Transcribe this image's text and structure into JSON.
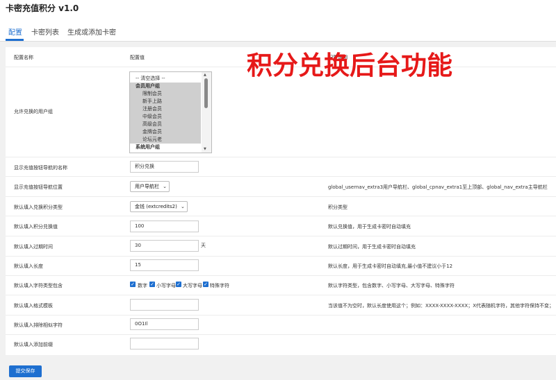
{
  "app": {
    "title": "卡密充值积分 v1.0"
  },
  "tabs": [
    {
      "label": "配置",
      "active": true
    },
    {
      "label": "卡密列表",
      "active": false
    },
    {
      "label": "生成或添加卡密",
      "active": false
    }
  ],
  "table": {
    "headers": {
      "name": "配置名称",
      "value": "配置值",
      "desc": "配置说明"
    }
  },
  "rows": {
    "user_groups": {
      "label": "允许兑换的用户组",
      "options": [
        {
          "text": "-- 清空选择 --",
          "kind": "clear",
          "selected": false
        },
        {
          "text": "会员用户组",
          "kind": "group",
          "selected": true
        },
        {
          "text": "限制会员",
          "kind": "opt",
          "selected": true
        },
        {
          "text": "新手上路",
          "kind": "opt",
          "selected": true
        },
        {
          "text": "注册会员",
          "kind": "opt",
          "selected": true
        },
        {
          "text": "中级会员",
          "kind": "opt",
          "selected": true
        },
        {
          "text": "高级会员",
          "kind": "opt",
          "selected": true
        },
        {
          "text": "金牌会员",
          "kind": "opt",
          "selected": true
        },
        {
          "text": "论坛元老",
          "kind": "opt",
          "selected": true
        },
        {
          "text": "系统用户组",
          "kind": "group",
          "selected": false
        }
      ]
    },
    "button_name": {
      "label": "显示充值按钮导航的名称",
      "value": "积分兑换"
    },
    "button_position": {
      "label": "显示充值按钮导航位置",
      "value": "用户导航栏",
      "desc": "global_usernav_extra3用户导航栏、global_cpnav_extra1至上顶部、global_nav_extra主导航栏"
    },
    "credit_type": {
      "label": "默认填入兑换积分类型",
      "value": "金钱 (extcredits2)",
      "desc": "积分类型"
    },
    "credit_value": {
      "label": "默认填入积分兑换值",
      "value": "100",
      "desc": "默认兑换值，用于生成卡密时自动填充"
    },
    "expire_time": {
      "label": "默认填入过期时间",
      "value": "30",
      "unit": "天",
      "desc": "默认过期时间，用于生成卡密时自动填充"
    },
    "length": {
      "label": "默认填入长度",
      "value": "15",
      "desc": "默认长度，用于生成卡密时自动填充,最小值不建议小于12"
    },
    "charset": {
      "label": "默认填入字符类型包含",
      "options": [
        {
          "text": "数字",
          "checked": true
        },
        {
          "text": "小写字母",
          "checked": true
        },
        {
          "text": "大写字母",
          "checked": true
        },
        {
          "text": "特殊字符",
          "checked": true
        }
      ],
      "desc": "默认字符类型，包含数字、小写字母、大写字母、特殊字符"
    },
    "format_template": {
      "label": "默认填入格式模板",
      "value": "",
      "desc": "当该值不为空时，默认长度使用这个；例如：XXXX-XXXX-XXXX；X代表随机字符，其他字符保持不变；"
    },
    "exclude_chars": {
      "label": "默认填入排除相似字符",
      "value": "0O1Il"
    },
    "prefix": {
      "label": "默认填入添加前缀",
      "value": ""
    }
  },
  "overlay_banner": "积分兑换后台功能",
  "submit": {
    "label": "提交保存"
  },
  "colors": {
    "accent": "#1e6fd0",
    "banner": "#e61919"
  }
}
